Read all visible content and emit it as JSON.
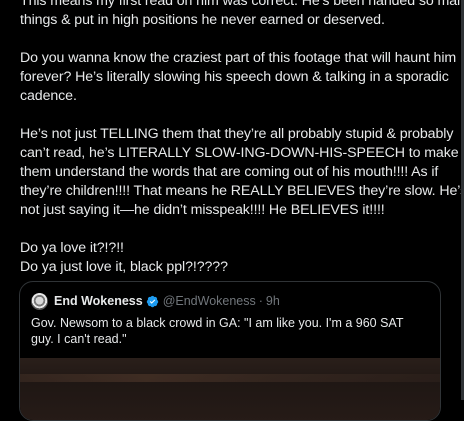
{
  "post": {
    "paragraphs": [
      {
        "lines": [
          "This means my first read on him was correct. He’s been handed so many",
          "things & put in high positions he never earned or deserved."
        ]
      },
      {
        "lines": [
          "Do you wanna know the craziest part of this footage that will haunt him",
          "forever? He’s literally slowing his speech down & talking in a sporadic",
          "cadence."
        ]
      },
      {
        "lines": [
          "He’s not just TELLING them that they’re all probably stupid & probably",
          "can’t read, he’s LITERALLY SLOW-ING-DOWN-HIS-SPEECH to make",
          "them understand the words that are coming out of his mouth!!!! As if",
          "they’re children!!!! That means he REALLY BELIEVES they’re slow. He’s",
          "not just saying it—he didn’t misspeak!!!! He BELIEVES it!!!!"
        ]
      },
      {
        "lines": [
          "Do ya love it?!?!!",
          "Do ya just love it, black ppl?!????"
        ]
      }
    ]
  },
  "quote": {
    "name": "End Wokeness",
    "handle": "@EndWokeness",
    "separator": "·",
    "time": "9h",
    "text": "Gov. Newsom to a black crowd in GA: \"I am like you. I'm a 960 SAT guy. I can't read.\"",
    "verified_icon": "verified-badge-icon"
  },
  "colors": {
    "background": "#000000",
    "text": "#e7e9ea",
    "muted": "#71767b",
    "border": "#2f3336",
    "verified": "#1d9bf0"
  }
}
